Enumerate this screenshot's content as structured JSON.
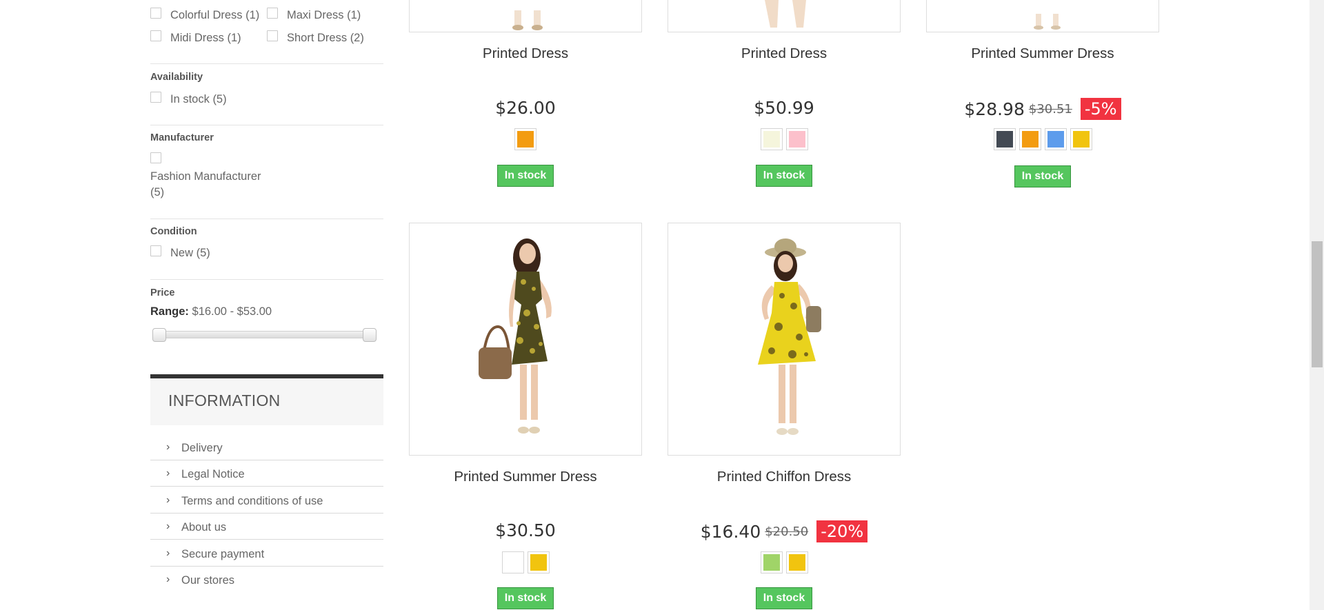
{
  "filters": {
    "categories": [
      {
        "label": "Colorful Dress (1)"
      },
      {
        "label": "Maxi Dress (1)"
      },
      {
        "label": "Midi Dress (1)"
      },
      {
        "label": "Short Dress (2)"
      }
    ],
    "availability": {
      "title": "Availability",
      "option": "In stock (5)"
    },
    "manufacturer": {
      "title": "Manufacturer",
      "option_line1": "Fashion Manufacturer",
      "option_line2": "(5)"
    },
    "condition": {
      "title": "Condition",
      "option": "New (5)"
    },
    "price": {
      "title": "Price",
      "range_label": "Range:",
      "range_value": "$16.00 - $53.00",
      "min": 16.0,
      "max": 53.0
    }
  },
  "information": {
    "title": "INFORMATION",
    "links": [
      {
        "label": "Delivery"
      },
      {
        "label": "Legal Notice"
      },
      {
        "label": "Terms and conditions of use"
      },
      {
        "label": "About us"
      },
      {
        "label": "Secure payment"
      },
      {
        "label": "Our stores"
      }
    ]
  },
  "products": [
    {
      "name": "Printed Dress",
      "price": "$26.00",
      "old_price": "",
      "discount": "",
      "colors": [
        "#f39c11"
      ],
      "stock": "In stock"
    },
    {
      "name": "Printed Dress",
      "price": "$50.99",
      "old_price": "",
      "discount": "",
      "colors": [
        "#f5f5dc",
        "#fcc0cb"
      ],
      "stock": "In stock"
    },
    {
      "name": "Printed Summer Dress",
      "price": "$28.98",
      "old_price": "$30.51",
      "discount": "-5%",
      "colors": [
        "#434a54",
        "#f39c11",
        "#5d9cec",
        "#f1c40f"
      ],
      "stock": "In stock"
    },
    {
      "name": "Printed Summer Dress",
      "price": "$30.50",
      "old_price": "",
      "discount": "",
      "colors": [
        "#ffffff",
        "#f1c40f"
      ],
      "stock": "In stock"
    },
    {
      "name": "Printed Chiffon Dress",
      "price": "$16.40",
      "old_price": "$20.50",
      "discount": "-20%",
      "colors": [
        "#a0d468",
        "#f1c40f"
      ],
      "stock": "In stock"
    }
  ]
}
